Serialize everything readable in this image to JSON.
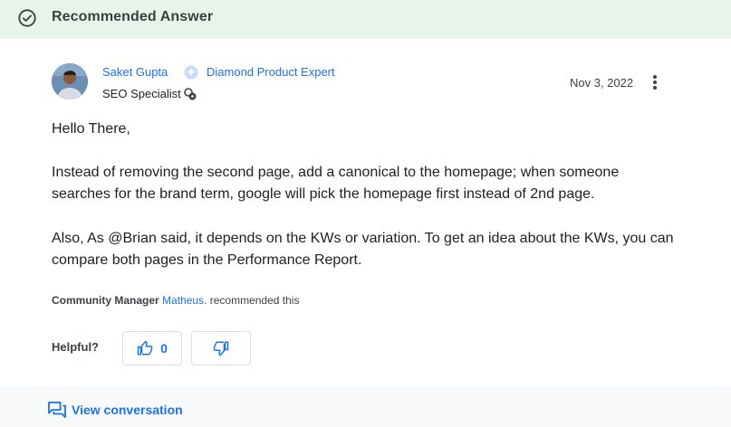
{
  "banner": {
    "title": "Recommended Answer",
    "icon": "check-circle-icon",
    "background_color": "#e6f4ea"
  },
  "author": {
    "name": "Saket Gupta",
    "badge_label": "Diamond Product Expert",
    "badge_icon": "diamond-badge-icon",
    "role": "SEO Specialist",
    "role_icon": "specialist-badge-icon"
  },
  "post": {
    "date": "Nov 3, 2022",
    "paragraphs": [
      "Hello There,",
      "Instead of removing the second page, add a canonical to the homepage; when someone searches for the brand term, google will pick the homepage first instead of 2nd page.",
      "Also, As @Brian said, it depends on the KWs or variation. To get an idea about the KWs, you can compare both pages in the Performance Report."
    ]
  },
  "recommendation": {
    "prefix": "Community Manager",
    "manager": "Matheus",
    "suffix": ". recommended this"
  },
  "helpful": {
    "label": "Helpful?",
    "upvote_count": "0"
  },
  "footer": {
    "link_label": "View conversation"
  },
  "colors": {
    "accent": "#1a73e8",
    "text": "#202124",
    "banner_green": "#e6f4ea"
  }
}
